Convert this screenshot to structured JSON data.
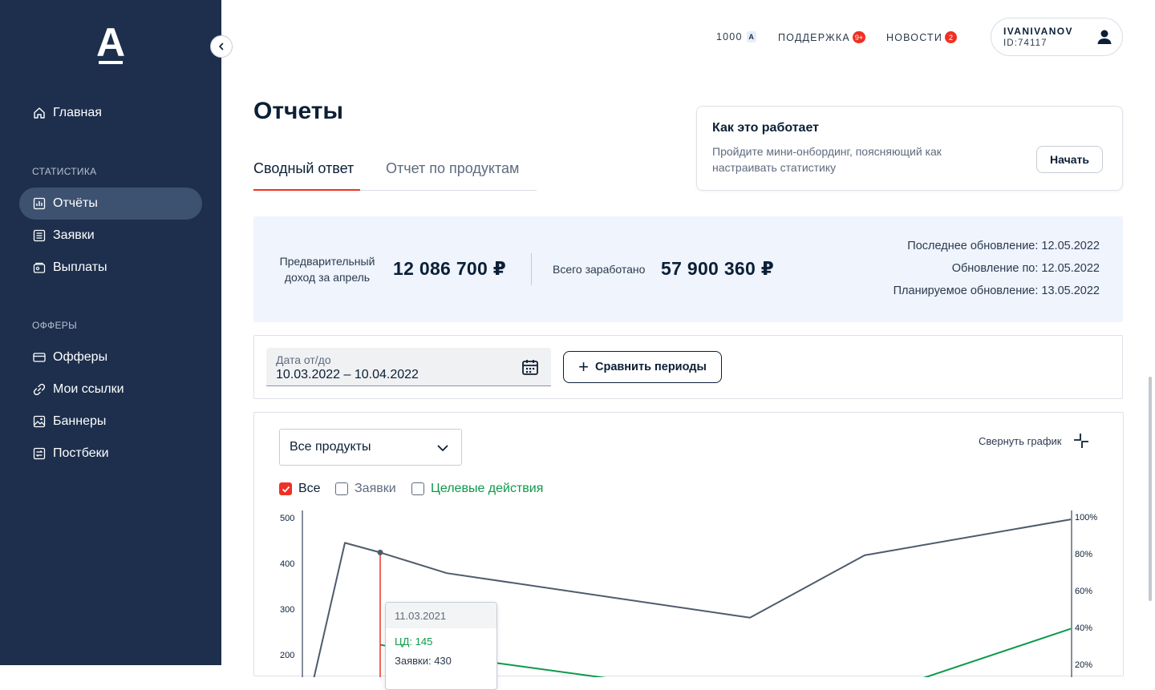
{
  "sidebar": {
    "logo": "А",
    "items_main": [
      {
        "label": "Главная",
        "icon": "home-icon"
      }
    ],
    "section_stats": "СТАТИСТИКА",
    "items_stats": [
      {
        "label": "Отчёты",
        "icon": "chart-icon",
        "active": true
      },
      {
        "label": "Заявки",
        "icon": "list-icon"
      },
      {
        "label": "Выплаты",
        "icon": "wallet-icon"
      }
    ],
    "section_offers": "ОФФЕРЫ",
    "items_offers": [
      {
        "label": "Офферы",
        "icon": "card-icon"
      },
      {
        "label": "Мои ссылки",
        "icon": "link-icon"
      },
      {
        "label": "Баннеры",
        "icon": "image-icon"
      },
      {
        "label": "Постбеки",
        "icon": "postback-icon"
      }
    ]
  },
  "topbar": {
    "balance": "1000",
    "balance_currency": "А",
    "support": "ПОДДЕРЖКА",
    "support_badge": "9+",
    "news": "НОВОСТИ",
    "news_badge": "2",
    "username": "IVANIVANOV",
    "user_id": "ID:74117"
  },
  "page": {
    "title": "Отчеты",
    "tabs": [
      "Сводный ответ",
      "Отчет по продуктам"
    ],
    "active_tab": 0
  },
  "howit": {
    "title": "Как это работает",
    "text": "Пройдите мини-онбординг, поясняющий как настраивать статистику",
    "button": "Начать"
  },
  "summary": {
    "prelim_label": "Предварительный доход за апрель",
    "prelim_value": "12 086 700 ₽",
    "total_label": "Всего заработано",
    "total_value": "57 900 360 ₽",
    "last_update": "Последнее обновление: 12.05.2022",
    "update_until": "Обновление по: 12.05.2022",
    "planned_update": "Планируемое обновление: 13.05.2022"
  },
  "filters": {
    "date_label": "Дата от/до",
    "date_value": "10.03.2022 – 10.04.2022",
    "compare_button": "Сравнить периоды"
  },
  "chart_controls": {
    "product_select": "Все продукты",
    "collapse_label": "Свернуть график",
    "checkboxes": [
      {
        "label": "Все",
        "checked": true
      },
      {
        "label": "Заявки",
        "checked": false
      },
      {
        "label": "Целевые действия",
        "checked": false
      }
    ]
  },
  "tooltip": {
    "date": "11.03.2021",
    "cd": "ЦД: 145",
    "requests": "Заявки: 430"
  },
  "colors": {
    "sidebar_bg": "#1d2f4d",
    "accent_red": "#ef3124",
    "series_gray": "#4f5b6b",
    "series_green": "#0b9a4a",
    "summary_bg": "#eff4fd"
  },
  "chart_data": {
    "type": "line",
    "y_left": {
      "ticks": [
        "500",
        "400",
        "300",
        "200"
      ],
      "range": [
        0,
        500
      ]
    },
    "y_right": {
      "ticks": [
        "100%",
        "80%",
        "60%",
        "40%",
        "20%"
      ],
      "range": [
        0,
        100
      ]
    },
    "grid": false,
    "series": [
      {
        "color": "#4f5b6b",
        "axis": "left",
        "points": [
          [
            0,
            150
          ],
          [
            1,
            447
          ],
          [
            2,
            426
          ],
          [
            3,
            381
          ],
          [
            4,
            284
          ],
          [
            5,
            420
          ],
          [
            6,
            498
          ]
        ]
      },
      {
        "color": "#0b9a4a",
        "axis": "left",
        "points": [
          [
            2,
            225
          ],
          [
            3,
            200
          ],
          [
            4,
            110
          ],
          [
            5,
            110
          ],
          [
            6,
            260
          ]
        ]
      }
    ]
  }
}
